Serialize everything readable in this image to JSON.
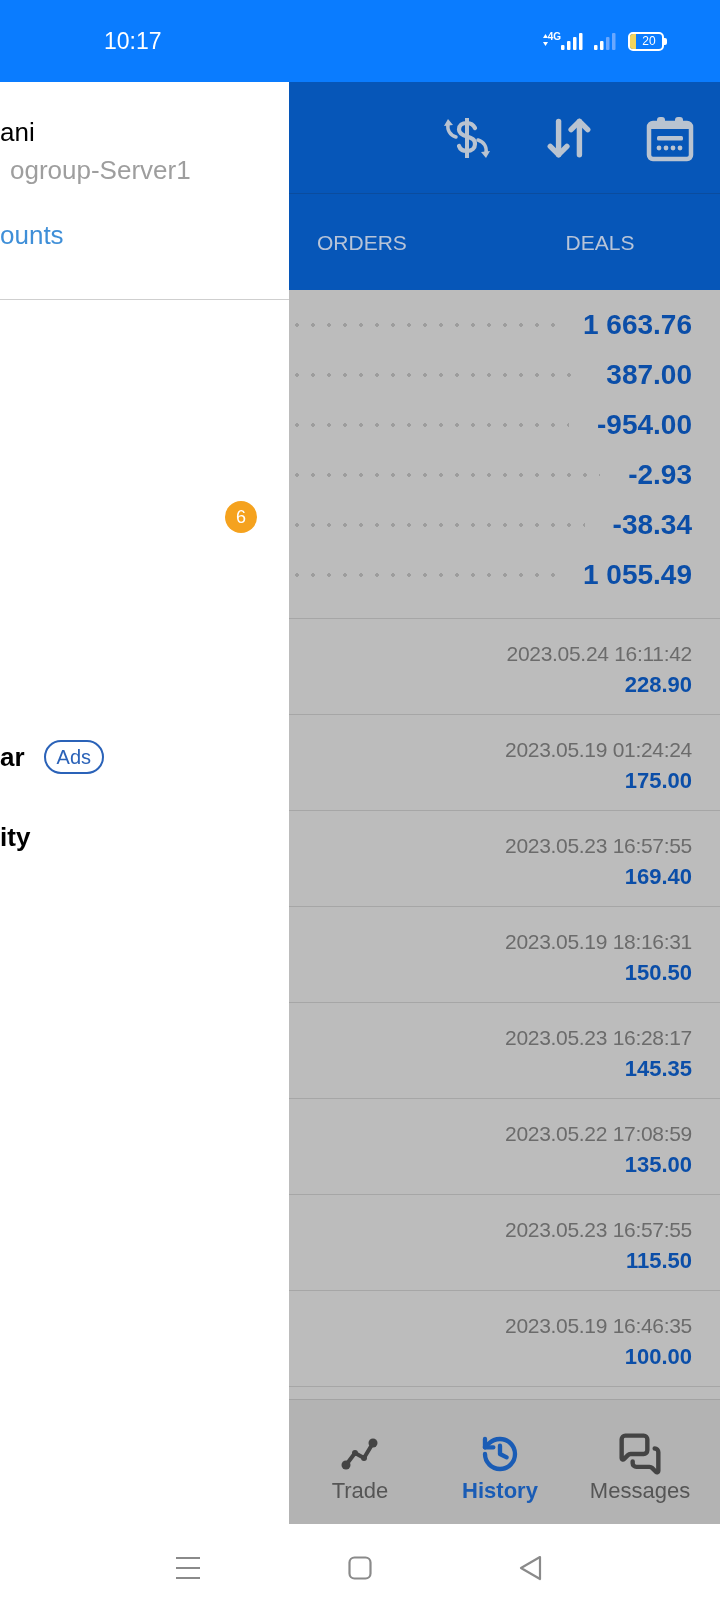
{
  "status_bar": {
    "time": "10:17",
    "network": "4G",
    "battery": "20"
  },
  "drawer": {
    "account_name": "ani",
    "server": "ogroup-Server1",
    "link": "ounts",
    "menu": [
      {
        "badge": "6"
      },
      {
        "label": "ar",
        "tag": "Ads"
      },
      {
        "label": "ity"
      }
    ]
  },
  "tabs": [
    {
      "label": "ORDERS"
    },
    {
      "label": "DEALS"
    }
  ],
  "summary": [
    {
      "value": "1 663.76"
    },
    {
      "value": "387.00"
    },
    {
      "value": "-954.00"
    },
    {
      "value": "-2.93"
    },
    {
      "value": "-38.34"
    },
    {
      "value": "1 055.49"
    }
  ],
  "deals": [
    {
      "time": "2023.05.24 16:11:42",
      "amount": "228.90"
    },
    {
      "time": "2023.05.19 01:24:24",
      "amount": "175.00"
    },
    {
      "time": "2023.05.23 16:57:55",
      "amount": "169.40"
    },
    {
      "time": "2023.05.19 18:16:31",
      "amount": "150.50"
    },
    {
      "time": "2023.05.23 16:28:17",
      "amount": "145.35"
    },
    {
      "time": "2023.05.22 17:08:59",
      "amount": "135.00"
    },
    {
      "time": "2023.05.23 16:57:55",
      "amount": "115.50"
    },
    {
      "time": "2023.05.19 16:46:35",
      "amount": "100.00"
    }
  ],
  "bottom_nav": [
    {
      "label": "Trade",
      "selected": false
    },
    {
      "label": "History",
      "selected": true
    },
    {
      "label": "Messages",
      "selected": false
    }
  ]
}
